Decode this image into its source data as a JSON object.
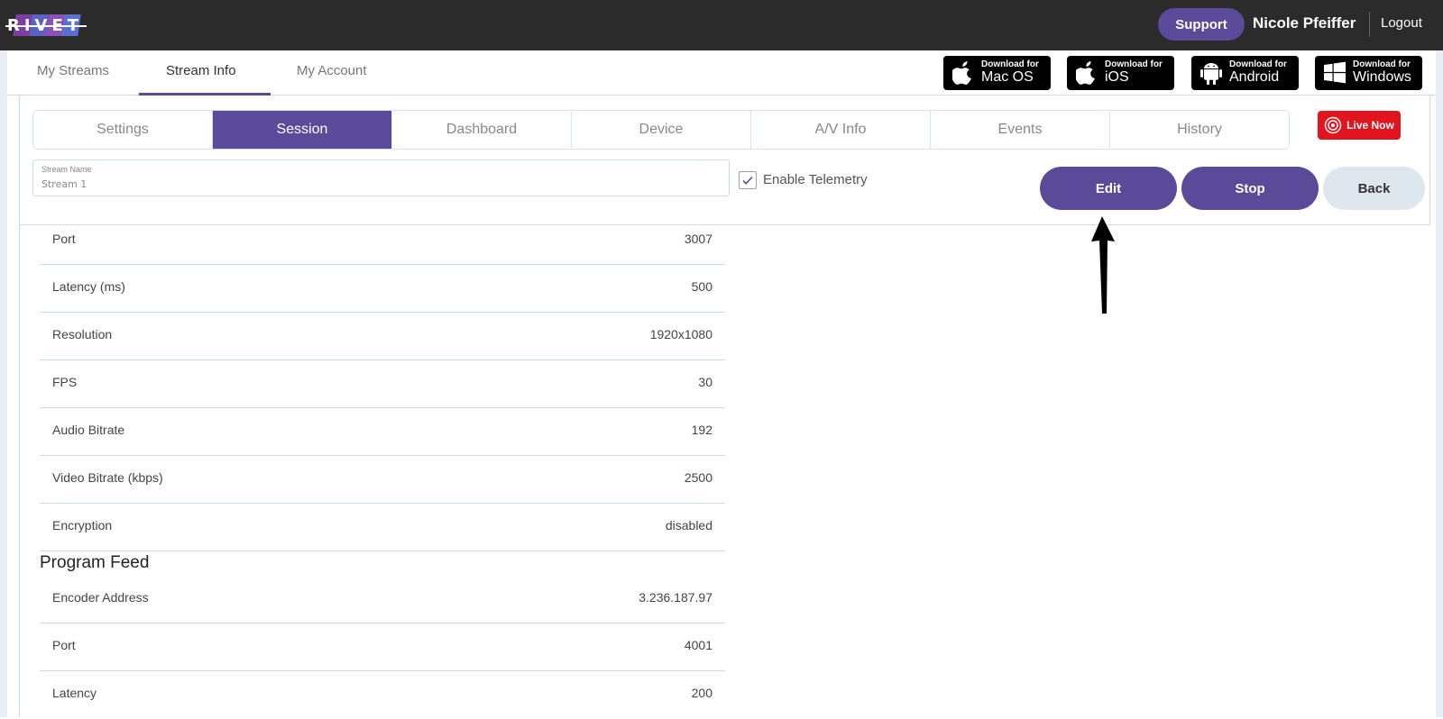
{
  "topbar": {
    "logo_text": "RIVET",
    "support_label": "Support",
    "user_name": "Nicole Pfeiffer",
    "logout_label": "Logout"
  },
  "nav": {
    "tabs": [
      {
        "label": "My Streams"
      },
      {
        "label": "Stream Info"
      },
      {
        "label": "My Account"
      }
    ],
    "active": "Stream Info"
  },
  "downloads": [
    {
      "small": "Download for",
      "big": "Mac OS",
      "icon": "apple-icon"
    },
    {
      "small": "Download for",
      "big": "iOS",
      "icon": "apple-icon"
    },
    {
      "small": "Download for",
      "big": "Android",
      "icon": "android-icon"
    },
    {
      "small": "Download for",
      "big": "Windows",
      "icon": "windows-icon"
    }
  ],
  "subtabs": [
    {
      "label": "Settings"
    },
    {
      "label": "Session"
    },
    {
      "label": "Dashboard"
    },
    {
      "label": "Device"
    },
    {
      "label": "A/V Info"
    },
    {
      "label": "Events"
    },
    {
      "label": "History"
    }
  ],
  "subtab_active": "Session",
  "live_label": "Live Now",
  "stream_name": {
    "label": "Stream Name",
    "value": "Stream 1"
  },
  "telemetry": {
    "label": "Enable Telemetry",
    "checked": true
  },
  "actions": {
    "edit": "Edit",
    "stop": "Stop",
    "back": "Back"
  },
  "rows": [
    {
      "label": "Port",
      "value": "3007"
    },
    {
      "label": "Latency (ms)",
      "value": "500"
    },
    {
      "label": "Resolution",
      "value": "1920x1080"
    },
    {
      "label": "FPS",
      "value": "30"
    },
    {
      "label": "Audio Bitrate",
      "value": "192"
    },
    {
      "label": "Video Bitrate (kbps)",
      "value": "2500"
    },
    {
      "label": "Encryption",
      "value": "disabled"
    }
  ],
  "program_feed": {
    "title": "Program Feed",
    "rows": [
      {
        "label": "Encoder Address",
        "value": "3.236.187.97"
      },
      {
        "label": "Port",
        "value": "4001"
      },
      {
        "label": "Latency",
        "value": "200"
      }
    ]
  },
  "colors": {
    "brand_purple": "#5b4a9a",
    "topbar": "#2b2b2b",
    "live_red": "#e3141e",
    "back_grey": "#dfe7ee"
  }
}
